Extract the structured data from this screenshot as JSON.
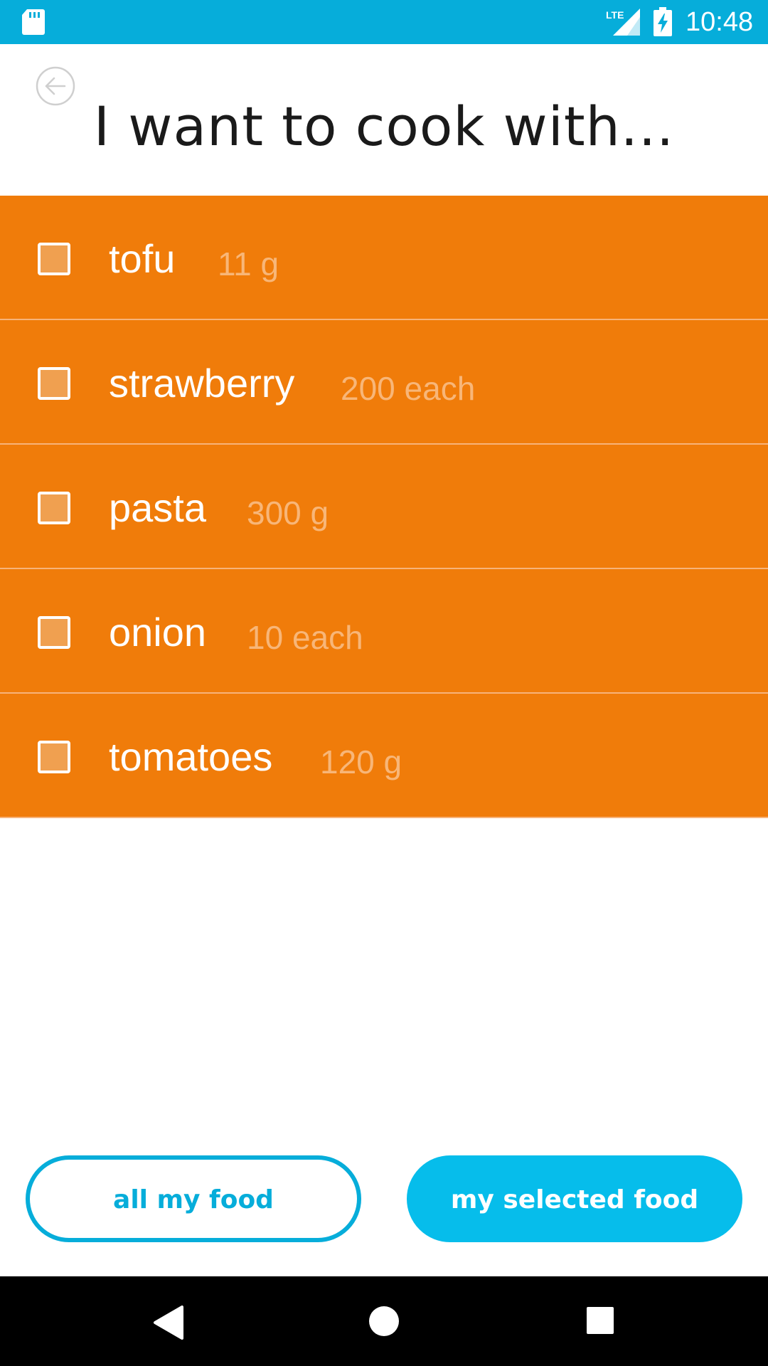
{
  "status_bar": {
    "time": "10:48",
    "network_label": "LTE",
    "icons": [
      "sd-card-icon",
      "lte-signal-icon",
      "battery-charging-icon"
    ],
    "background_color": "#06ADDA"
  },
  "header": {
    "title": "I want to cook with...",
    "back_icon": "back-arrow-circle-icon"
  },
  "food_items": [
    {
      "name": "tofu",
      "quantity": "11 g",
      "checked": false
    },
    {
      "name": "strawberry",
      "quantity": "200 each",
      "checked": false
    },
    {
      "name": "pasta",
      "quantity": "300 g",
      "checked": false
    },
    {
      "name": "onion",
      "quantity": "10 each",
      "checked": false
    },
    {
      "name": "tomatoes",
      "quantity": "120 g",
      "checked": false
    }
  ],
  "list_color": "#F07C0A",
  "buttons": {
    "all_food": "all my food",
    "selected_food": "my selected food"
  },
  "accent_color": "#06ADDA",
  "nav_bar": {
    "icons": [
      "nav-back-icon",
      "nav-home-icon",
      "nav-recents-icon"
    ]
  }
}
